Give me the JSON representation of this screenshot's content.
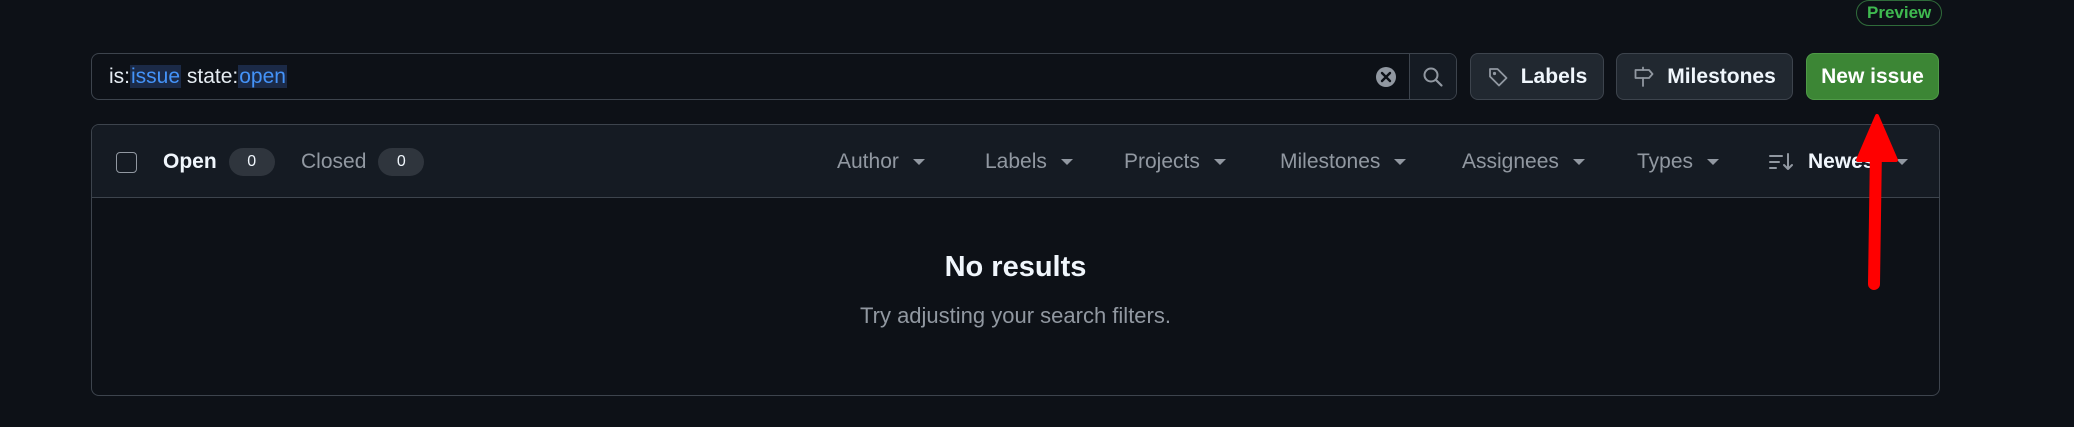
{
  "header": {
    "preview_badge": "Preview"
  },
  "search": {
    "tokens": [
      {
        "text": "is:",
        "qualifier": false
      },
      {
        "text": "issue",
        "qualifier": true
      },
      {
        "text": " state:",
        "qualifier": false
      },
      {
        "text": "open",
        "qualifier": true
      }
    ],
    "clear_icon": "x-circle-fill-icon",
    "search_icon": "search-icon"
  },
  "toolbar": {
    "labels_label": "Labels",
    "labels_icon": "tag-icon",
    "milestones_label": "Milestones",
    "milestones_icon": "milestone-icon",
    "new_issue_label": "New issue",
    "new_issue_color": "#3c8635"
  },
  "list_header": {
    "open_label": "Open",
    "open_count": "0",
    "closed_label": "Closed",
    "closed_count": "0",
    "filters": [
      "Author",
      "Labels",
      "Projects",
      "Milestones",
      "Assignees",
      "Types"
    ],
    "sort_label": "Newest",
    "sort_icon": "sort-desc-icon"
  },
  "empty_state": {
    "title": "No results",
    "subtitle": "Try adjusting your search filters."
  },
  "annotation": {
    "arrow_color": "#ff0000"
  }
}
